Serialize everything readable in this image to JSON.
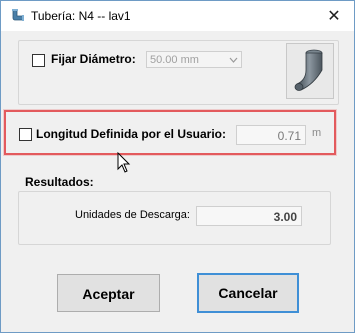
{
  "window": {
    "title": "Tubería: N4 -- lav1",
    "close_glyph": "✕"
  },
  "fijar_diametro": {
    "label": "Fijar Diámetro:",
    "checked": false,
    "dropdown_value": "50.00 mm"
  },
  "longitud": {
    "label": "Longitud Definida por el Usuario:",
    "checked": false,
    "value": "0.71",
    "unit": "m"
  },
  "resultados": {
    "title": "Resultados:",
    "unidades_label": "Unidades de Descarga:",
    "unidades_value": "3.00"
  },
  "buttons": {
    "accept": "Aceptar",
    "cancel": "Cancelar"
  },
  "colors": {
    "highlight": "#e35a5d",
    "default_button_border": "#3f8fd6",
    "pipe": "#5f6b75"
  },
  "icons": {
    "app": "pipe-app-icon",
    "preview": "pipe-elbow-icon",
    "cursor": "mouse-pointer-icon"
  }
}
